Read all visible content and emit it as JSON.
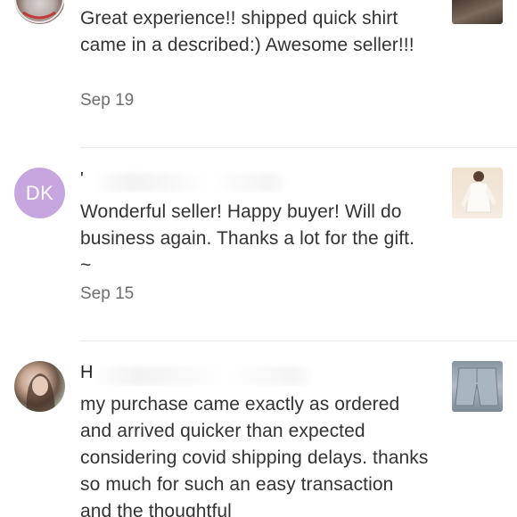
{
  "reviews": [
    {
      "avatar_initials": "",
      "name": "",
      "text": "Great experience!! shipped quick shirt came in a described:) Awesome seller!!!",
      "date": "Sep 19"
    },
    {
      "avatar_initials": "DK",
      "name": "'",
      "text": "Wonderful seller! Happy buyer! Will do business again. Thanks a lot for the gift. ~",
      "date": "Sep 15"
    },
    {
      "avatar_initials": "",
      "name": "H",
      "text": "my purchase came exactly as ordered and arrived quicker than expected considering covid shipping delays. thanks so much for such an easy transaction and the thoughtful",
      "date": ""
    }
  ],
  "colors": {
    "avatar_initials_bg": "#c7a6e0",
    "divider": "#ececec",
    "date_text": "#6e6e6e"
  }
}
